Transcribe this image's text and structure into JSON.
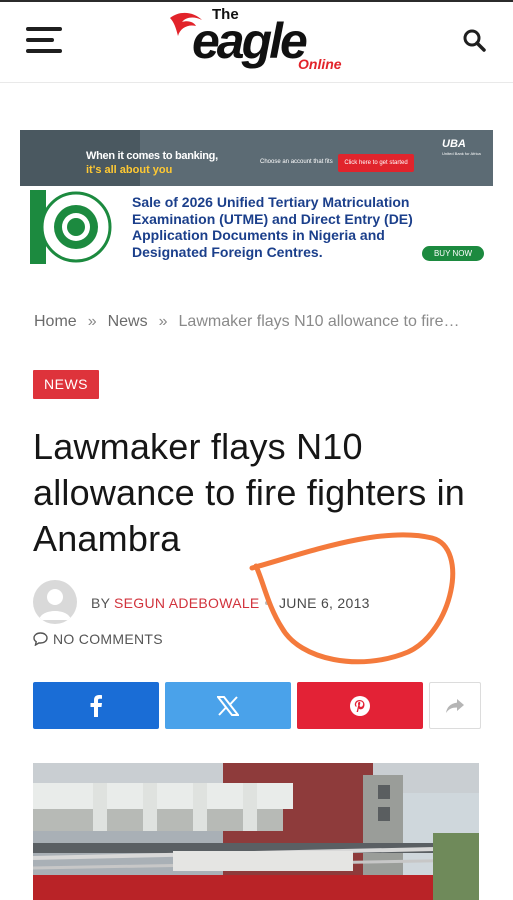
{
  "header": {
    "logo_the": "The",
    "logo_eagle": "eagle",
    "logo_online": "Online",
    "menu_icon": "hamburger-menu-icon",
    "search_icon": "search-icon"
  },
  "ads": {
    "uba": {
      "line1": "When it comes to banking,",
      "line2": "it's all about you",
      "choose": "Choose an account that fits",
      "cta": "Click here to get started",
      "logo": "UBA",
      "sub": "United Bank for Africa"
    },
    "jamb": {
      "text": "Sale of 2026 Unified Tertiary Matriculation Examination (UTME) and Direct Entry (DE) Application Documents in Nigeria and Designated Foreign Centres.",
      "cta": "BUY NOW",
      "seal_text": "JAMB"
    }
  },
  "breadcrumb": {
    "home": "Home",
    "news": "News",
    "current": "Lawmaker flays N10 allowance to fire…",
    "separator": "»"
  },
  "article": {
    "category": "NEWS",
    "title": "Lawmaker flays N10 allowance to fire fighters in Anambra",
    "by": "BY",
    "author": "SEGUN ADEBOWALE",
    "date": "JUNE 6, 2013",
    "comments": "NO COMMENTS"
  },
  "share": {
    "facebook_icon": "facebook-icon",
    "x_icon": "x-icon",
    "pinterest_icon": "pinterest-icon",
    "more_icon": "share-arrow-icon"
  },
  "colors": {
    "accent_red": "#de333b",
    "facebook": "#1a6dd6",
    "x": "#4aa2ea",
    "pinterest": "#e32236",
    "annotation_orange": "#f47a3c"
  }
}
